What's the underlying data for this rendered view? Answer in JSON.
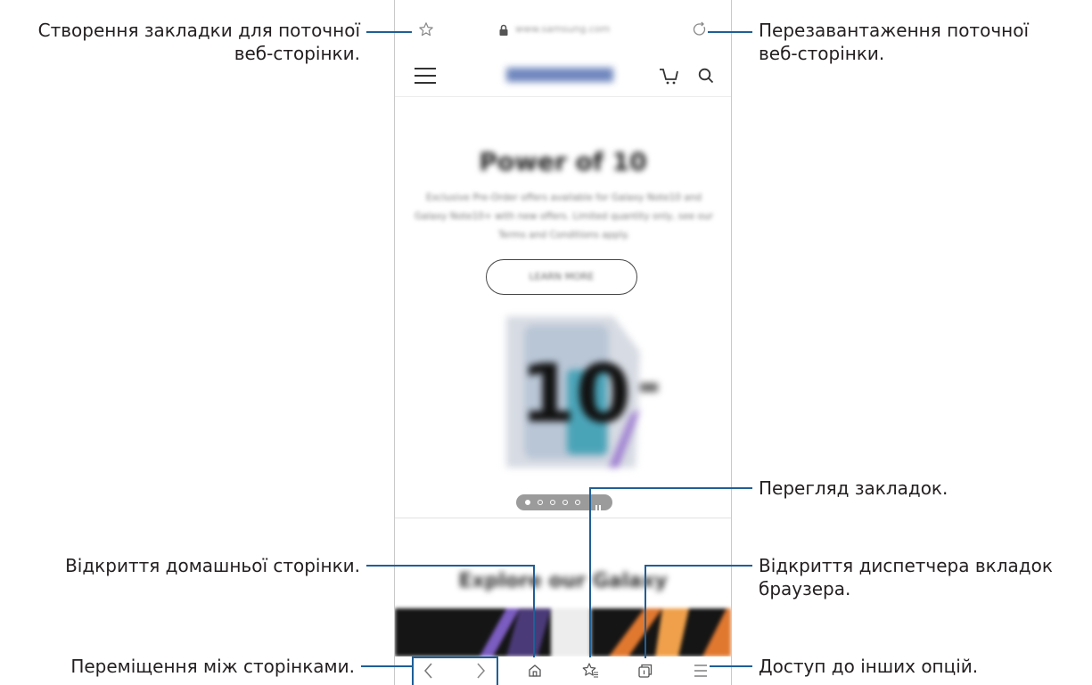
{
  "callouts": {
    "bookmark_add": [
      "Створення закладки для поточної",
      "веб-сторінки."
    ],
    "reload": [
      "Перезавантаження поточної",
      "веб-сторінки."
    ],
    "view_bookmarks": "Перегляд закладок.",
    "home": "Відкриття домашньої сторінки.",
    "tab_manager": [
      "Відкриття диспетчера вкладок",
      "браузера."
    ],
    "navigate": "Переміщення між сторінками.",
    "more_options": "Доступ до інших опцій."
  },
  "browser": {
    "url": "www.samsung.com",
    "brand": "SAMSUNG",
    "hero_title": "Power of 10",
    "hero_desc": "Exclusive Pre-Order offers available for Galaxy Note10 and Galaxy Note10+ with new offers. Limited quantity only, see our Terms and Conditions apply.",
    "learn_button": "LEARN MORE",
    "product_number": "10",
    "section_title": "Explore our Galaxy"
  },
  "colors": {
    "callout_line": "#1f5f97",
    "icon": "#888888"
  }
}
